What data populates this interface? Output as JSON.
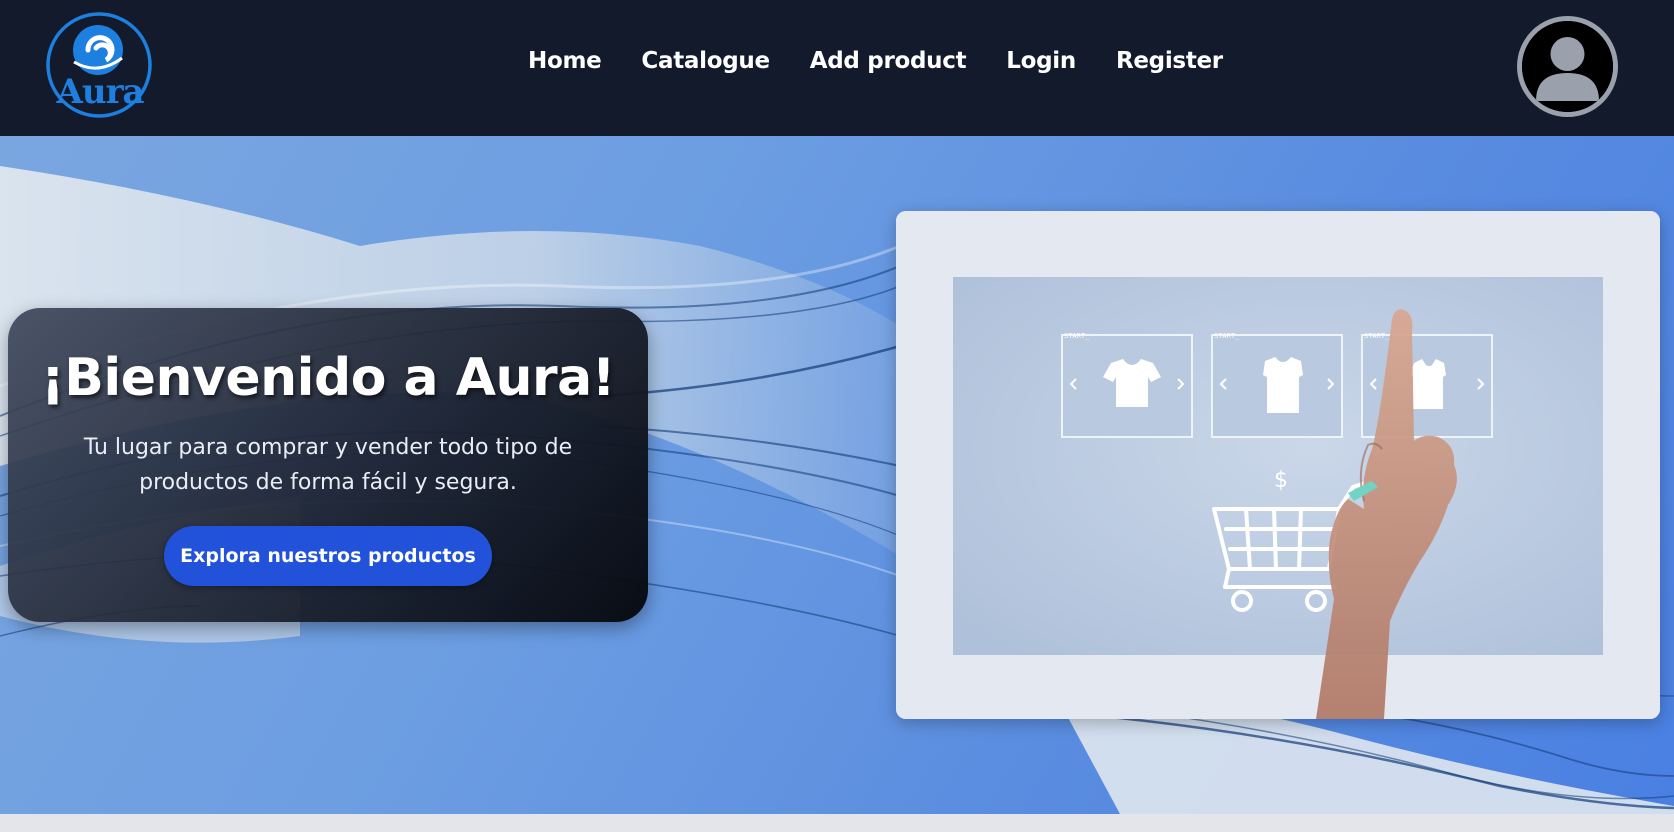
{
  "header": {
    "logo_text": "Aura",
    "nav": [
      {
        "label": "Home"
      },
      {
        "label": "Catalogue"
      },
      {
        "label": "Add product"
      },
      {
        "label": "Login"
      },
      {
        "label": "Register"
      }
    ],
    "avatar_icon": "user-avatar-icon"
  },
  "hero": {
    "title": "¡Bienvenido a Aura!",
    "subtitle": "Tu lugar para comprar y vender todo tipo de productos de forma fácil y segura.",
    "cta_label": "Explora nuestros productos",
    "image": {
      "panel_labels": [
        "START_",
        "START_",
        "START_"
      ],
      "price_symbol": "$"
    }
  },
  "colors": {
    "navbar_bg": "#121a2b",
    "logo_blue": "#1d7fe0",
    "cta_blue": "#2152d9",
    "hero_blue": "#5b8ee0"
  }
}
